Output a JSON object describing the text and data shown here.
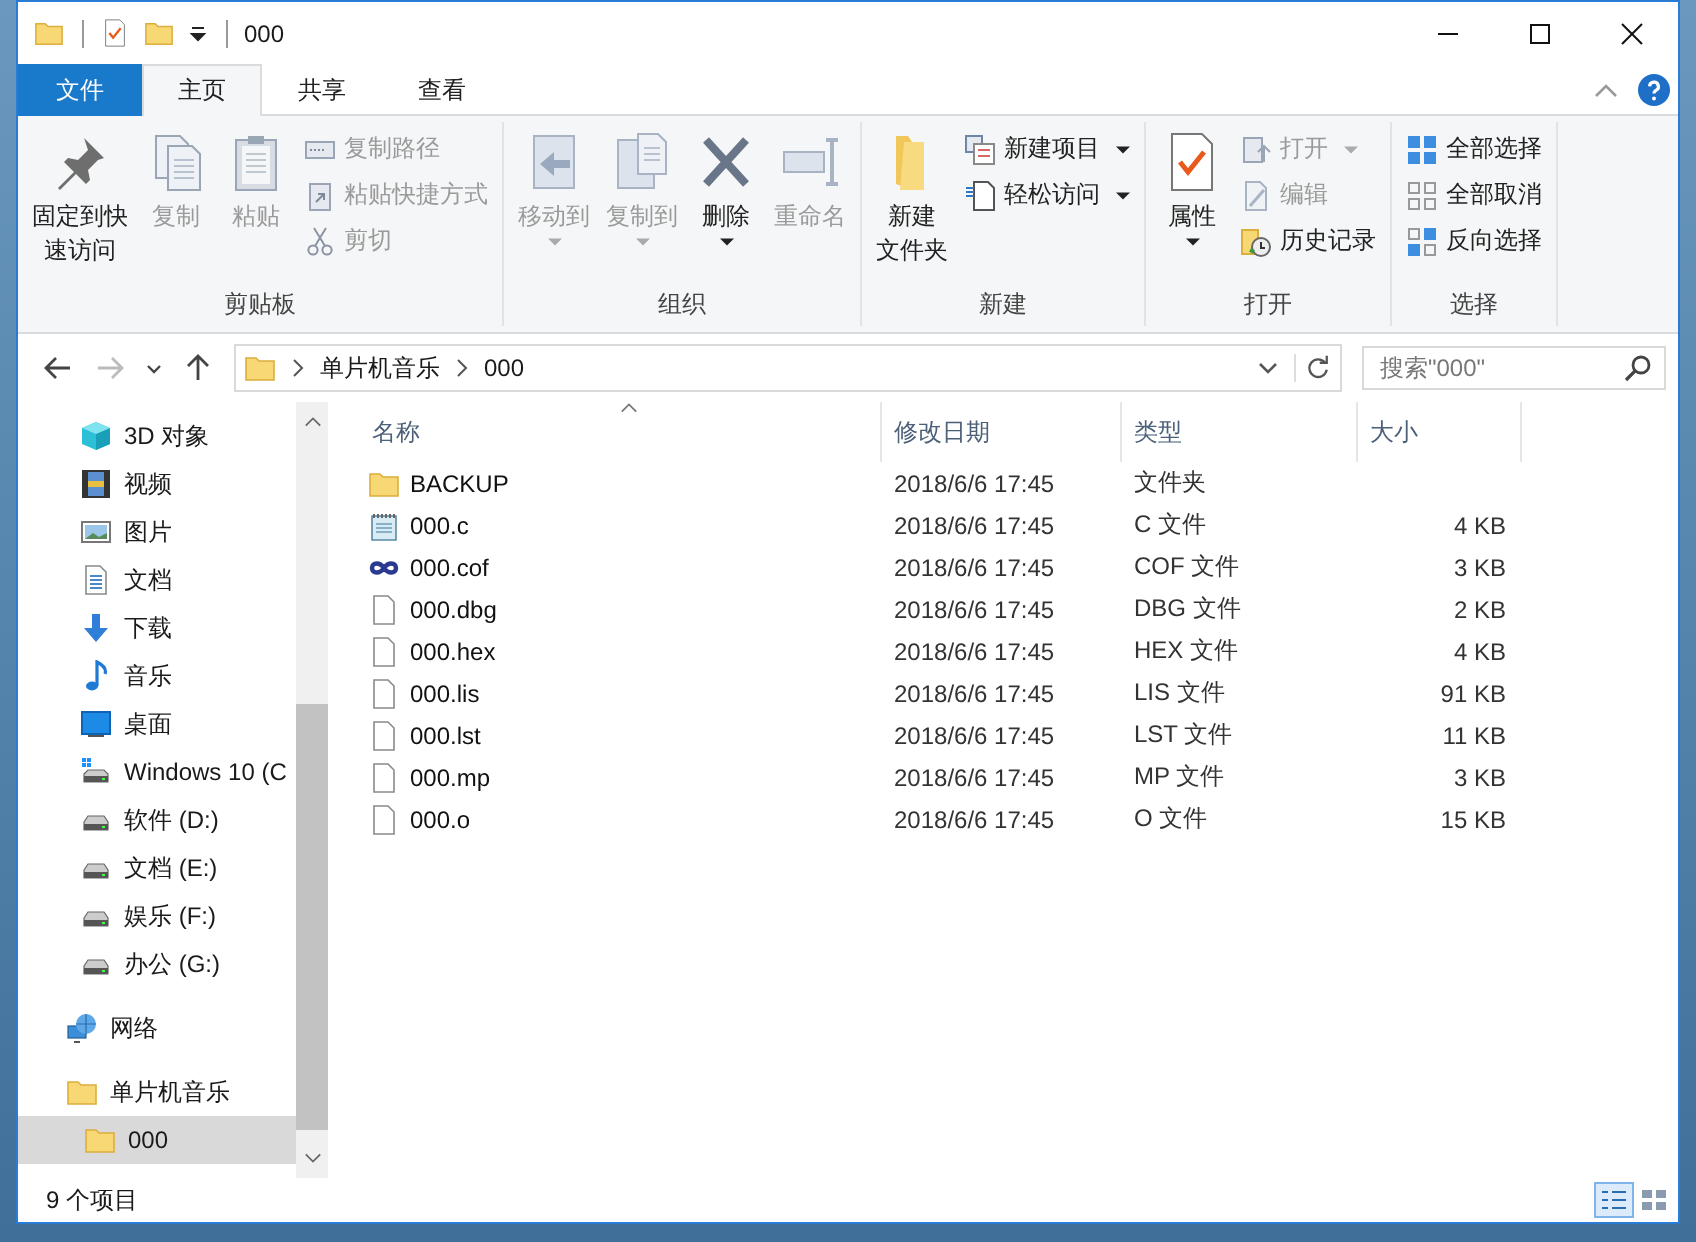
{
  "window": {
    "title": "000"
  },
  "tabs": [
    {
      "label": "文件",
      "kind": "file",
      "selected": false
    },
    {
      "label": "主页",
      "kind": "tab",
      "selected": true
    },
    {
      "label": "共享",
      "kind": "tab",
      "selected": false
    },
    {
      "label": "查看",
      "kind": "tab",
      "selected": false
    }
  ],
  "ribbon": {
    "groups": [
      {
        "label": "剪贴板",
        "large": [
          {
            "kind": "pin",
            "lines": [
              "固定到快",
              "速访问"
            ],
            "disabled": false,
            "dropdown": false
          },
          {
            "kind": "copy",
            "lines": [
              "复制"
            ],
            "disabled": true,
            "dropdown": false
          },
          {
            "kind": "paste",
            "lines": [
              "粘贴"
            ],
            "disabled": true,
            "dropdown": false
          }
        ],
        "small": [
          {
            "kind": "copypath",
            "label": "复制路径",
            "disabled": true,
            "dropdown": false
          },
          {
            "kind": "pasteshortcut",
            "label": "粘贴快捷方式",
            "disabled": true,
            "dropdown": false
          },
          {
            "kind": "cut",
            "label": "剪切",
            "disabled": true,
            "dropdown": false
          }
        ]
      },
      {
        "label": "组织",
        "large": [
          {
            "kind": "move",
            "lines": [
              "移动到"
            ],
            "disabled": true,
            "dropdown": true
          },
          {
            "kind": "copyto",
            "lines": [
              "复制到"
            ],
            "disabled": true,
            "dropdown": true
          },
          {
            "kind": "delete",
            "lines": [
              "删除"
            ],
            "disabled": false,
            "dropdown": true
          },
          {
            "kind": "rename",
            "lines": [
              "重命名"
            ],
            "disabled": true,
            "dropdown": false
          }
        ]
      },
      {
        "label": "新建",
        "large": [
          {
            "kind": "newfolder",
            "lines": [
              "新建",
              "文件夹"
            ],
            "disabled": false,
            "dropdown": false
          }
        ],
        "small": [
          {
            "kind": "newitem",
            "label": "新建项目",
            "disabled": false,
            "dropdown": true
          },
          {
            "kind": "easyaccess",
            "label": "轻松访问",
            "disabled": false,
            "dropdown": true
          }
        ]
      },
      {
        "label": "打开",
        "large": [
          {
            "kind": "properties",
            "lines": [
              "属性"
            ],
            "disabled": false,
            "dropdown": true
          }
        ],
        "small": [
          {
            "kind": "open",
            "label": "打开",
            "disabled": true,
            "dropdown": true
          },
          {
            "kind": "edit",
            "label": "编辑",
            "disabled": true,
            "dropdown": false
          },
          {
            "kind": "history",
            "label": "历史记录",
            "disabled": false,
            "dropdown": false
          }
        ]
      },
      {
        "label": "选择",
        "small": [
          {
            "kind": "selectall",
            "label": "全部选择",
            "disabled": false,
            "dropdown": false
          },
          {
            "kind": "selectnone",
            "label": "全部取消",
            "disabled": false,
            "dropdown": false
          },
          {
            "kind": "invert",
            "label": "反向选择",
            "disabled": false,
            "dropdown": false
          }
        ]
      }
    ]
  },
  "nav_buttons": [
    {
      "kind": "back",
      "disabled": false
    },
    {
      "kind": "forward",
      "disabled": true
    },
    {
      "kind": "recent",
      "disabled": false
    },
    {
      "kind": "up",
      "disabled": false
    }
  ],
  "address": {
    "path": [
      "单片机音乐",
      "000"
    ]
  },
  "search": {
    "placeholder": "搜索\"000\""
  },
  "sidebar": {
    "items": [
      {
        "label": "3D 对象",
        "kind": "cube",
        "selected": false
      },
      {
        "label": "视频",
        "kind": "video",
        "selected": false
      },
      {
        "label": "图片",
        "kind": "pictures",
        "selected": false
      },
      {
        "label": "文档",
        "kind": "documents",
        "selected": false
      },
      {
        "label": "下载",
        "kind": "downloads",
        "selected": false
      },
      {
        "label": "音乐",
        "kind": "music",
        "selected": false
      },
      {
        "label": "桌面",
        "kind": "desktop",
        "selected": false
      },
      {
        "label": "Windows 10 (C",
        "kind": "windrive",
        "selected": false
      },
      {
        "label": "软件 (D:)",
        "kind": "drive",
        "selected": false
      },
      {
        "label": "文档 (E:)",
        "kind": "drive",
        "selected": false
      },
      {
        "label": "娱乐 (F:)",
        "kind": "drive",
        "selected": false
      },
      {
        "label": "办公 (G:)",
        "kind": "drive",
        "selected": false
      },
      {
        "label": "网络",
        "kind": "network",
        "selected": false
      },
      {
        "label": "单片机音乐",
        "kind": "folder",
        "selected": false,
        "children": [
          {
            "label": "000",
            "kind": "folder",
            "selected": true
          }
        ]
      }
    ]
  },
  "table": {
    "columns": [
      {
        "label": "名称",
        "sorted": true
      },
      {
        "label": "修改日期",
        "sorted": false
      },
      {
        "label": "类型",
        "sorted": false
      },
      {
        "label": "大小",
        "sorted": false
      }
    ],
    "rows": [
      {
        "kind": "folder",
        "name": "BACKUP",
        "modified": "2018/6/6 17:45",
        "type": "文件夹",
        "size": ""
      },
      {
        "kind": "text",
        "name": "000.c",
        "modified": "2018/6/6 17:45",
        "type": "C 文件",
        "size": "4 KB"
      },
      {
        "kind": "cof",
        "name": "000.cof",
        "modified": "2018/6/6 17:45",
        "type": "COF 文件",
        "size": "3 KB"
      },
      {
        "kind": "file",
        "name": "000.dbg",
        "modified": "2018/6/6 17:45",
        "type": "DBG 文件",
        "size": "2 KB"
      },
      {
        "kind": "file",
        "name": "000.hex",
        "modified": "2018/6/6 17:45",
        "type": "HEX 文件",
        "size": "4 KB"
      },
      {
        "kind": "file",
        "name": "000.lis",
        "modified": "2018/6/6 17:45",
        "type": "LIS 文件",
        "size": "91 KB"
      },
      {
        "kind": "file",
        "name": "000.lst",
        "modified": "2018/6/6 17:45",
        "type": "LST 文件",
        "size": "11 KB"
      },
      {
        "kind": "file",
        "name": "000.mp",
        "modified": "2018/6/6 17:45",
        "type": "MP 文件",
        "size": "3 KB"
      },
      {
        "kind": "file",
        "name": "000.o",
        "modified": "2018/6/6 17:45",
        "type": "O 文件",
        "size": "15 KB"
      }
    ]
  },
  "status_bar": {
    "text": "9 个项目",
    "views": [
      {
        "kind": "details",
        "selected": true
      },
      {
        "kind": "tiles",
        "selected": false
      }
    ]
  }
}
